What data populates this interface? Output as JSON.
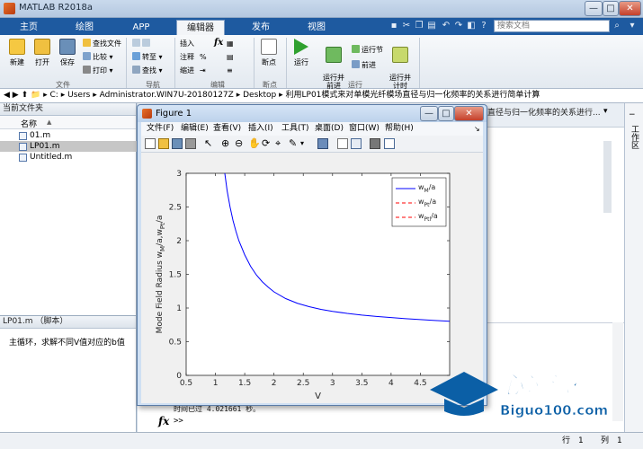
{
  "app": {
    "title": "MATLAB R2018a"
  },
  "window_buttons": {
    "min": "—",
    "max": "□",
    "close": "✕"
  },
  "ribbon_tabs": [
    "主页",
    "绘图",
    "APP",
    "编辑器",
    "发布",
    "视图"
  ],
  "search": {
    "placeholder": "搜索文档"
  },
  "ribbon": {
    "file": {
      "new": "新建",
      "open": "打开",
      "save": "保存",
      "find_files": "查找文件",
      "compare": "比较",
      "print": "打印",
      "group": "文件"
    },
    "navigate": {
      "goto": "转至",
      "find": "查找",
      "group": "导航"
    },
    "edit": {
      "insert": "插入",
      "comment": "注释",
      "indent": "缩进",
      "fx": "fx",
      "group": "编辑"
    },
    "breakpoints": {
      "label": "断点",
      "group": "断点"
    },
    "run": {
      "run": "运行",
      "run_advance": "运行并\n前进",
      "run_section": "运行节",
      "advance": "前进",
      "run_time": "运行并\n计时",
      "group": "运行"
    }
  },
  "address": {
    "segments": [
      "C:",
      "Users",
      "Administrator.WIN7U-20180127Z",
      "Desktop",
      "利用LP01模式来对单模光纤模场直径与归一化频率的关系进行简单计算"
    ]
  },
  "current_folder": {
    "header": "当前文件夹",
    "col_name": "名称",
    "sort_arrow": "▲",
    "files": [
      {
        "name": "01.m",
        "selected": false
      },
      {
        "name": "LP01.m",
        "selected": true
      },
      {
        "name": "Untitled.m",
        "selected": false
      }
    ]
  },
  "details": {
    "header": "LP01.m （脚本）",
    "text": "主循环，求解不同V值对应的b值"
  },
  "editor_strip_text": "直径与归一化频率的关系进行...",
  "side_label": "工作区",
  "command": {
    "output": "时间已过 4.021661 秒。",
    "prompt_symbol": "fx",
    "prompt": ">>"
  },
  "status": {
    "row_label": "行",
    "row": "1",
    "col_label": "列",
    "col": "1"
  },
  "figure": {
    "title": "Figure 1",
    "menus": [
      "文件(F)",
      "编辑(E)",
      "查看(V)",
      "插入(I)",
      "工具(T)",
      "桌面(D)",
      "窗口(W)",
      "帮助(H)"
    ]
  },
  "chart_data": {
    "type": "line",
    "xlabel": "V",
    "ylabel_main": "Mode Field Radius w",
    "ylabel_s1": "M",
    "ylabel_mid": "/a,w",
    "ylabel_s2": "Pt",
    "ylabel_end": "/a",
    "xlim": [
      0.5,
      5
    ],
    "ylim": [
      0,
      3
    ],
    "xticks": [
      "0.5",
      "1",
      "1.5",
      "2",
      "2.5",
      "3",
      "3.5",
      "4",
      "4.5"
    ],
    "yticks": [
      "0",
      "0.5",
      "1",
      "1.5",
      "2",
      "2.5",
      "3"
    ],
    "grid": false,
    "legend_position": "top-right",
    "series": [
      {
        "name": "w_M/a",
        "legend_main": "w",
        "legend_sub": "M",
        "legend_tail": "/a",
        "color": "#0000ff",
        "style": "solid",
        "x": [
          1.16,
          1.2,
          1.25,
          1.3,
          1.35,
          1.4,
          1.5,
          1.6,
          1.7,
          1.8,
          1.9,
          2.0,
          2.2,
          2.4,
          2.6,
          2.8,
          3.0,
          3.25,
          3.5,
          3.75,
          4.0,
          4.25,
          4.5,
          4.75,
          5.0
        ],
        "y": [
          3.0,
          2.74,
          2.5,
          2.3,
          2.14,
          2.0,
          1.79,
          1.62,
          1.49,
          1.39,
          1.31,
          1.24,
          1.14,
          1.07,
          1.02,
          0.98,
          0.95,
          0.92,
          0.895,
          0.875,
          0.858,
          0.842,
          0.828,
          0.815,
          0.803
        ]
      },
      {
        "name": "w_Pt/a",
        "legend_main": "w",
        "legend_sub": "Pt",
        "legend_tail": "/a",
        "color": "#ff0000",
        "style": "dashed",
        "x": [],
        "y": []
      },
      {
        "name": "w_Pt/a",
        "legend_main": "w",
        "legend_sub": "Ptl",
        "legend_tail": "/a",
        "color": "#ff0000",
        "style": "dashed",
        "x": [],
        "y": []
      }
    ]
  },
  "watermark": {
    "title": "必过源码",
    "url": "Biguo100.com"
  }
}
